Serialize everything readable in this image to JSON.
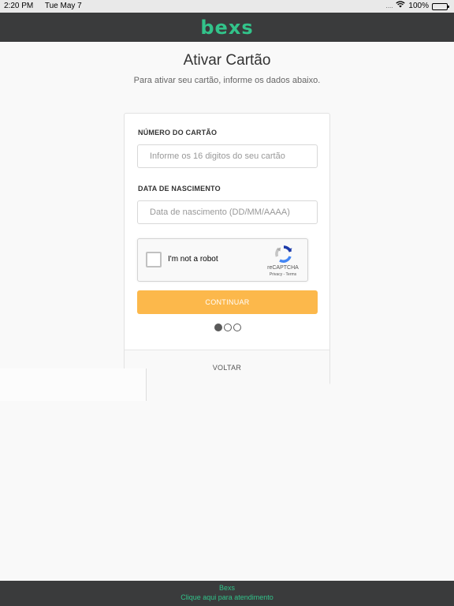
{
  "status_bar": {
    "time": "2:20 PM",
    "date": "Tue May 7",
    "signal": "....",
    "battery": "100%"
  },
  "header": {
    "logo": "bexs",
    "brand_color": "#32c38a"
  },
  "page": {
    "title": "Ativar Cartão",
    "subtitle": "Para ativar seu cartão, informe os dados abaixo."
  },
  "form": {
    "card_number": {
      "label": "NÚMERO DO CARTÃO",
      "placeholder": "Informe os 16 digitos do seu cartão",
      "value": ""
    },
    "birth_date": {
      "label": "DATA DE NASCIMENTO",
      "placeholder": "Data de nascimento (DD/MM/AAAA)",
      "value": ""
    },
    "recaptcha": {
      "label": "I'm not a robot",
      "brand": "reCAPTCHA",
      "terms": "Privacy - Terms"
    },
    "continue_label": "CONTINUAR",
    "continue_color": "#fcb84b",
    "steps": {
      "current": 1,
      "total": 3
    },
    "back_label": "VOLTAR"
  },
  "footer": {
    "brand": "Bexs",
    "link": "Clique aqui para atendimento"
  }
}
